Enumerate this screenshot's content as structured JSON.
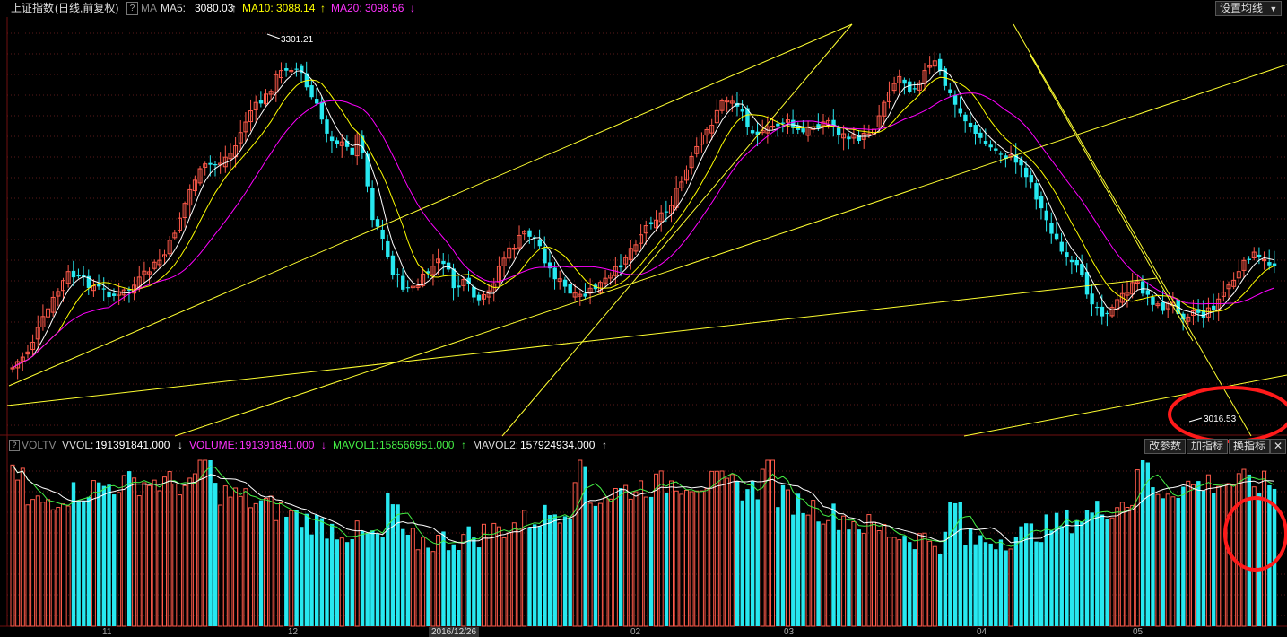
{
  "header": {
    "title": "上证指数",
    "mode": "(日线,前复权)",
    "indicator": "MA",
    "ma5_label": "MA5:",
    "ma5_value": "3080.03",
    "ma10_label": "MA10:",
    "ma10_value": "3088.14",
    "ma20_label": "MA20:",
    "ma20_value": "3098.56",
    "settings_button": "设置均线"
  },
  "annotations": {
    "high_label": "3301.21",
    "low_label": "3016.53"
  },
  "volume_header": {
    "indicator": "VOLTV",
    "vvol_label": "VVOL:",
    "vvol_value": "191391841.000",
    "volume_label": "VOLUME:",
    "volume_value": "191391841.000",
    "mavol1_label": "MAVOL1:",
    "mavol1_value": "158566951.000",
    "mavol2_label": "MAVOL2:",
    "mavol2_value": "157924934.000",
    "btn_params": "改参数",
    "btn_add": "加指标",
    "btn_change": "换指标",
    "btn_close": "✕"
  },
  "x_axis": {
    "labels": [
      "11",
      "12",
      "2016/12/26",
      "02",
      "03",
      "04",
      "05"
    ]
  },
  "colors": {
    "up": "#ff5a4a",
    "down": "#27e8f0",
    "ma5": "#ffffff",
    "ma10": "#ffff00",
    "ma20": "#ff00ff",
    "trend": "#ffff30",
    "highlight": "#ff1a1a"
  }
}
